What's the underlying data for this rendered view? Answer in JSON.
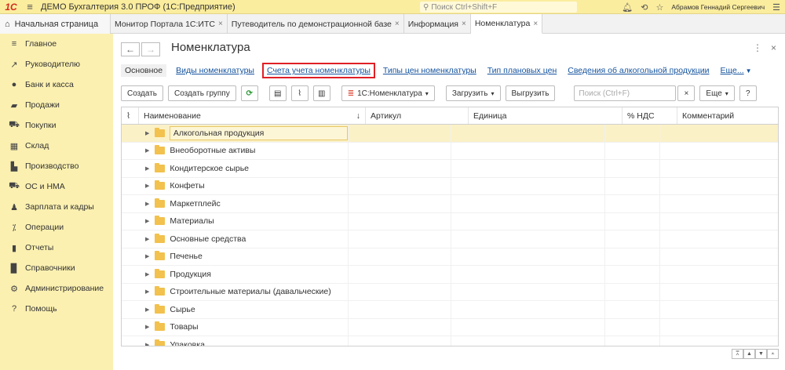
{
  "app": {
    "title": "ДЕМО Бухгалтерия 3.0 ПРОФ  (1С:Предприятие)",
    "logo": "1С",
    "global_search_placeholder": "Поиск Ctrl+Shift+F",
    "user": "Абрамов Геннадий Сергеевич"
  },
  "tabs": {
    "home": "Начальная страница",
    "items": [
      {
        "label": "Монитор Портала 1С:ИТС"
      },
      {
        "label": "Путеводитель по демонстрационной базе"
      },
      {
        "label": "Информация"
      },
      {
        "label": "Номенклатура"
      }
    ]
  },
  "sidebar": {
    "items": [
      {
        "label": "Главное",
        "icon": "menu-icon"
      },
      {
        "label": "Руководителю",
        "icon": "trend-icon"
      },
      {
        "label": "Банк и касса",
        "icon": "coin-icon"
      },
      {
        "label": "Продажи",
        "icon": "bag-icon"
      },
      {
        "label": "Покупки",
        "icon": "cart-icon"
      },
      {
        "label": "Склад",
        "icon": "warehouse-icon"
      },
      {
        "label": "Производство",
        "icon": "factory-icon"
      },
      {
        "label": "ОС и НМА",
        "icon": "truck-icon"
      },
      {
        "label": "Зарплата и кадры",
        "icon": "person-icon"
      },
      {
        "label": "Операции",
        "icon": "operations-icon"
      },
      {
        "label": "Отчеты",
        "icon": "chart-icon"
      },
      {
        "label": "Справочники",
        "icon": "book-icon"
      },
      {
        "label": "Администрирование",
        "icon": "gear-icon"
      },
      {
        "label": "Помощь",
        "icon": "help-icon"
      }
    ]
  },
  "form": {
    "title": "Номенклатура",
    "links": {
      "main": "Основное",
      "types": "Виды номенклатуры",
      "accounts": "Счета учета номенклатуры",
      "price_types": "Типы цен номенклатуры",
      "plan_prices": "Тип плановых цен",
      "alcohol": "Сведения об алкогольной продукции",
      "more": "Еще..."
    },
    "toolbar": {
      "create": "Создать",
      "create_group": "Создать группу",
      "nomenclature_1c": "1С:Номенклатура",
      "load": "Загрузить",
      "unload": "Выгрузить",
      "search_placeholder": "Поиск (Ctrl+F)",
      "more": "Еще",
      "help": "?"
    },
    "columns": {
      "name": "Наименование",
      "article": "Артикул",
      "unit": "Единица",
      "vat": "% НДС",
      "comment": "Комментарий"
    },
    "rows": [
      "Алкогольная продукция",
      "Внеоборотные активы",
      "Кондитерское сырье",
      "Конфеты",
      "Маркетплейс",
      "Материалы",
      "Основные средства",
      "Печенье",
      "Продукция",
      "Строительные материалы (давальческие)",
      "Сырье",
      "Товары",
      "Упаковка"
    ]
  }
}
